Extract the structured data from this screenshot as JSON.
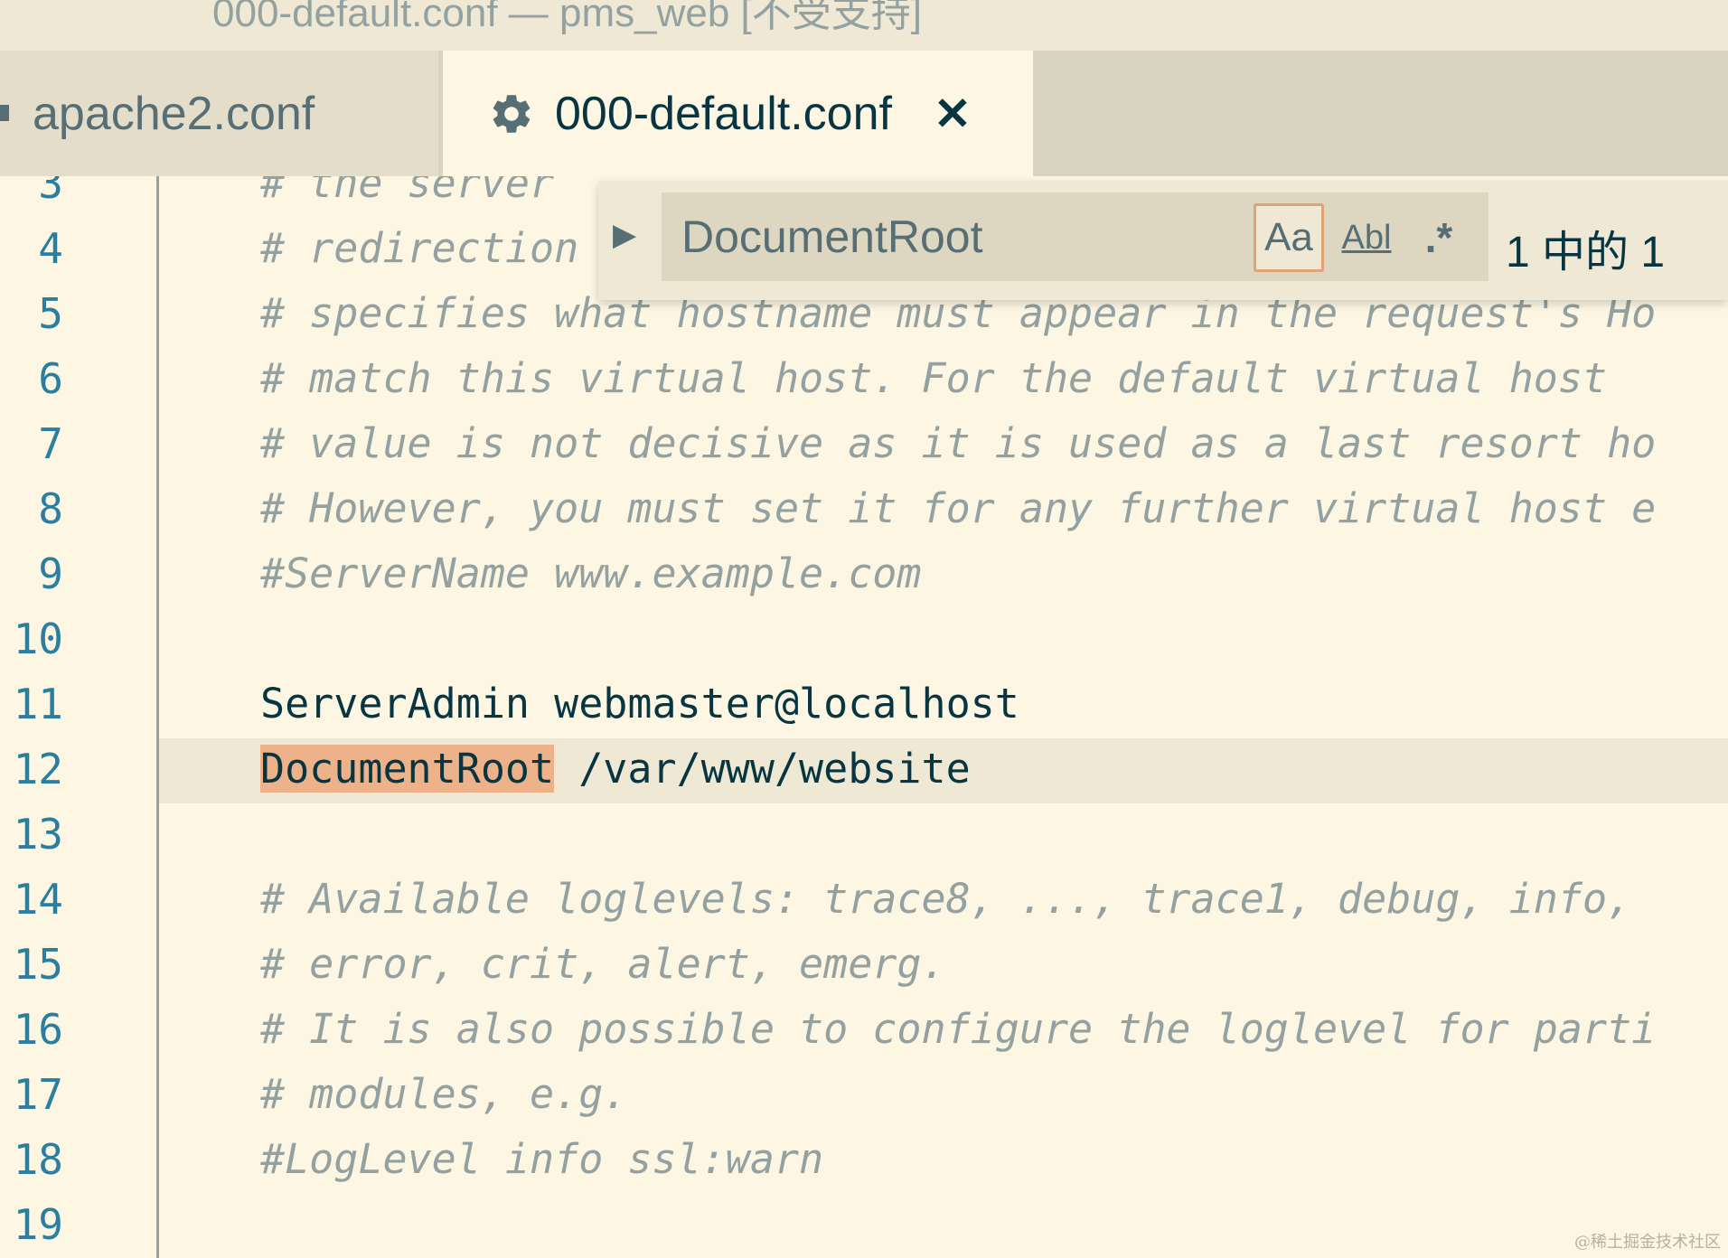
{
  "window": {
    "title": "000-default.conf — pms_web [不受支持]"
  },
  "tabs": [
    {
      "label": "apache2.conf",
      "active": false
    },
    {
      "label": "000-default.conf",
      "active": true,
      "icon": "gear-icon",
      "close": "✕"
    }
  ],
  "find": {
    "query": "DocumentRoot",
    "toggle_icon": "chevron-right-icon",
    "options": {
      "match_case": "Aa",
      "whole_word": "Abl",
      "regex": ".*"
    },
    "result": "1 中的 1"
  },
  "editor": {
    "lines": [
      {
        "num": "3",
        "text": "# the server",
        "type": "comment"
      },
      {
        "num": "4",
        "text": "# redirection",
        "type": "comment"
      },
      {
        "num": "5",
        "text": "# specifies what hostname must appear in the request's Ho",
        "type": "comment"
      },
      {
        "num": "6",
        "text": "# match this virtual host. For the default virtual host",
        "type": "comment"
      },
      {
        "num": "7",
        "text": "# value is not decisive as it is used as a last resort ho",
        "type": "comment"
      },
      {
        "num": "8",
        "text": "# However, you must set it for any further virtual host e",
        "type": "comment"
      },
      {
        "num": "9",
        "text": "#ServerName www.example.com",
        "type": "comment"
      },
      {
        "num": "10",
        "text": "",
        "type": "code"
      },
      {
        "num": "11",
        "text": "ServerAdmin webmaster@localhost",
        "type": "code"
      },
      {
        "num": "12",
        "match": "DocumentRoot",
        "rest": " /var/www/website",
        "type": "code"
      },
      {
        "num": "13",
        "text": "",
        "type": "code"
      },
      {
        "num": "14",
        "text": "# Available loglevels: trace8, ..., trace1, debug, info,",
        "type": "comment"
      },
      {
        "num": "15",
        "text": "# error, crit, alert, emerg.",
        "type": "comment"
      },
      {
        "num": "16",
        "text": "# It is also possible to configure the loglevel for parti",
        "type": "comment"
      },
      {
        "num": "17",
        "text": "# modules, e.g.",
        "type": "comment"
      },
      {
        "num": "18",
        "text": "#LogLevel info ssl:warn",
        "type": "comment"
      },
      {
        "num": "19",
        "text": "",
        "type": "code"
      }
    ]
  },
  "watermark": "@稀土掘金技术社区"
}
